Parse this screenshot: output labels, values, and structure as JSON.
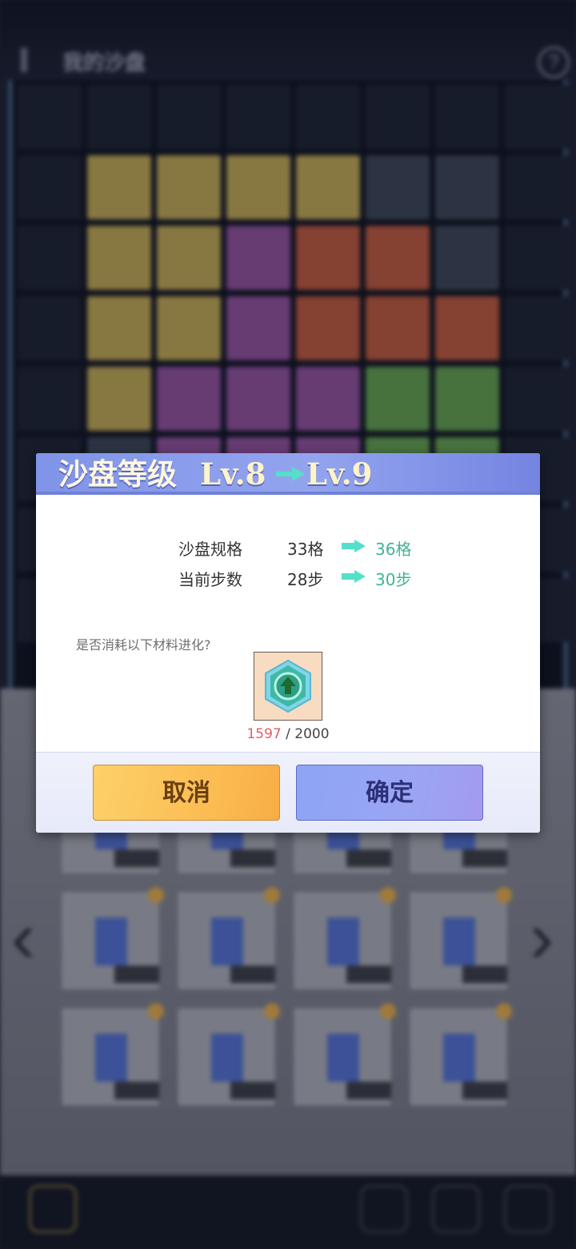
{
  "background": {
    "title": "我的沙盘",
    "help_symbol": "?",
    "nav_prev": "‹",
    "nav_next": "›"
  },
  "dialog": {
    "title": "沙盘等级",
    "level_from": "Lv.8",
    "level_to": "Lv.9",
    "stats": [
      {
        "label": "沙盘规格",
        "current": "33格",
        "next": "36格"
      },
      {
        "label": "当前步数",
        "current": "28步",
        "next": "30步"
      }
    ],
    "question": "是否消耗以下材料进化?",
    "material": {
      "icon": "upgrade-gem-icon",
      "have": "1597",
      "separator": " / ",
      "need": "2000"
    },
    "cancel_label": "取消",
    "confirm_label": "确定"
  },
  "colors": {
    "header": "#8094e8",
    "accent_green": "#3fb596",
    "arrow_cyan": "#54e0c8",
    "insufficient_red": "#e25d6b",
    "cancel_yellow": "#fbba4f",
    "confirm_blue": "#9aa5f3"
  }
}
